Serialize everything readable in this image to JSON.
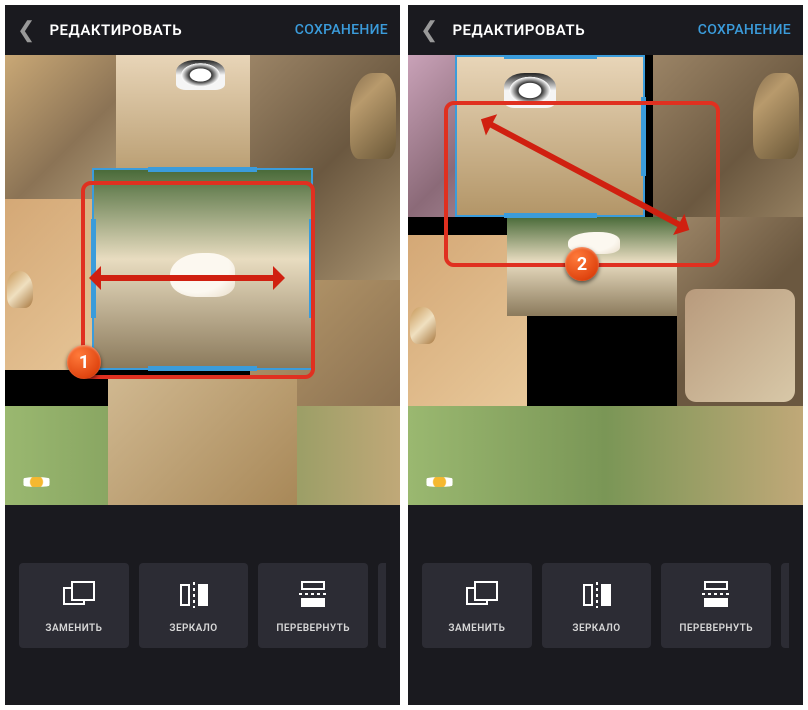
{
  "colors": {
    "accent": "#3b9cdb",
    "annotation": "#e03020",
    "panel_bg": "#1a1a1f",
    "tool_bg": "#2c2c34"
  },
  "screens": [
    {
      "header": {
        "title": "РЕДАКТИРОВАТЬ",
        "save_label": "СОХРАНЕНИЕ"
      },
      "annotation": {
        "badge": "1",
        "gesture": "horizontal-resize"
      },
      "selected_frame": "rabbit-photo",
      "tools": [
        {
          "id": "replace",
          "label": "ЗАМЕНИТЬ",
          "icon": "replace-icon"
        },
        {
          "id": "mirror",
          "label": "ЗЕРКАЛО",
          "icon": "mirror-icon"
        },
        {
          "id": "flip",
          "label": "ПЕРЕВЕРНУТЬ",
          "icon": "flip-icon"
        }
      ]
    },
    {
      "header": {
        "title": "РЕДАКТИРОВАТЬ",
        "save_label": "СОХРАНЕНИЕ"
      },
      "annotation": {
        "badge": "2",
        "gesture": "diagonal-resize"
      },
      "selected_frame": "dogs-photo",
      "tools": [
        {
          "id": "replace",
          "label": "ЗАМЕНИТЬ",
          "icon": "replace-icon"
        },
        {
          "id": "mirror",
          "label": "ЗЕРКАЛО",
          "icon": "mirror-icon"
        },
        {
          "id": "flip",
          "label": "ПЕРЕВЕРНУТЬ",
          "icon": "flip-icon"
        }
      ]
    }
  ]
}
